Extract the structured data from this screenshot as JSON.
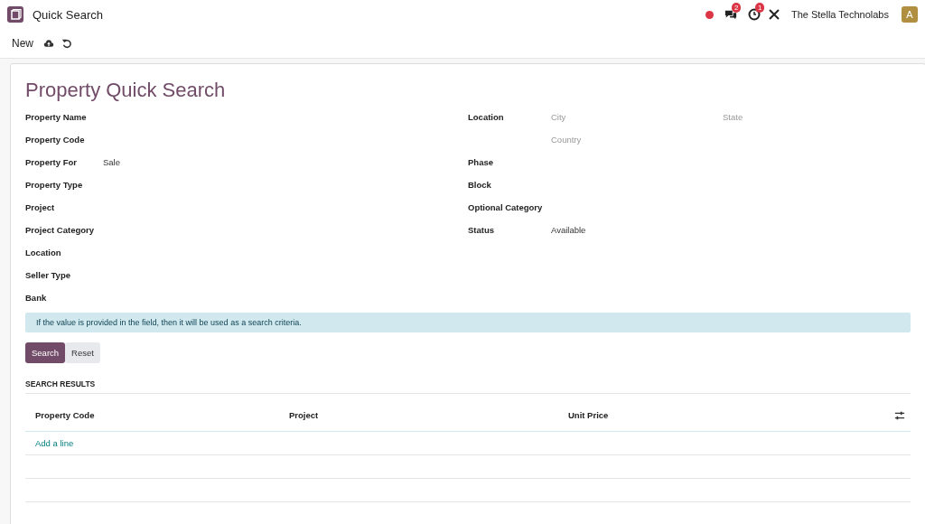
{
  "app": {
    "title": "Quick Search"
  },
  "systray": {
    "messages_count": "2",
    "activities_count": "1",
    "company": "The Stella Technolabs",
    "avatar": "A"
  },
  "control_panel": {
    "new_button": "New"
  },
  "form": {
    "title": "Property Quick Search",
    "left_fields": [
      {
        "label": "Property Name"
      },
      {
        "label": "Property Code"
      },
      {
        "label": "Property For",
        "value": "Sale"
      },
      {
        "label": "Property Type"
      },
      {
        "label": "Project"
      },
      {
        "label": "Project Category"
      },
      {
        "label": "Location"
      },
      {
        "label": "Seller Type"
      },
      {
        "label": "Bank"
      }
    ],
    "right_fields": [
      {
        "kind": "address",
        "label": "Location",
        "city_placeholder": "City",
        "state_placeholder": "State",
        "country_placeholder": "Country"
      },
      {
        "kind": "text",
        "label": "Phase"
      },
      {
        "kind": "text",
        "label": "Block"
      },
      {
        "kind": "text",
        "label": "Optional Category"
      },
      {
        "kind": "text",
        "label": "Status",
        "value": "Available"
      }
    ],
    "info_alert": "If the value is provided in the field, then it will be used as a search criteria.",
    "buttons": [
      {
        "label": "Search",
        "kind": "primary"
      },
      {
        "label": "Reset",
        "kind": "secondary"
      }
    ],
    "results": {
      "heading": "SEARCH RESULTS",
      "columns": [
        "Property Code",
        "Project",
        "Unit Price"
      ],
      "add_line": "Add a line"
    }
  }
}
